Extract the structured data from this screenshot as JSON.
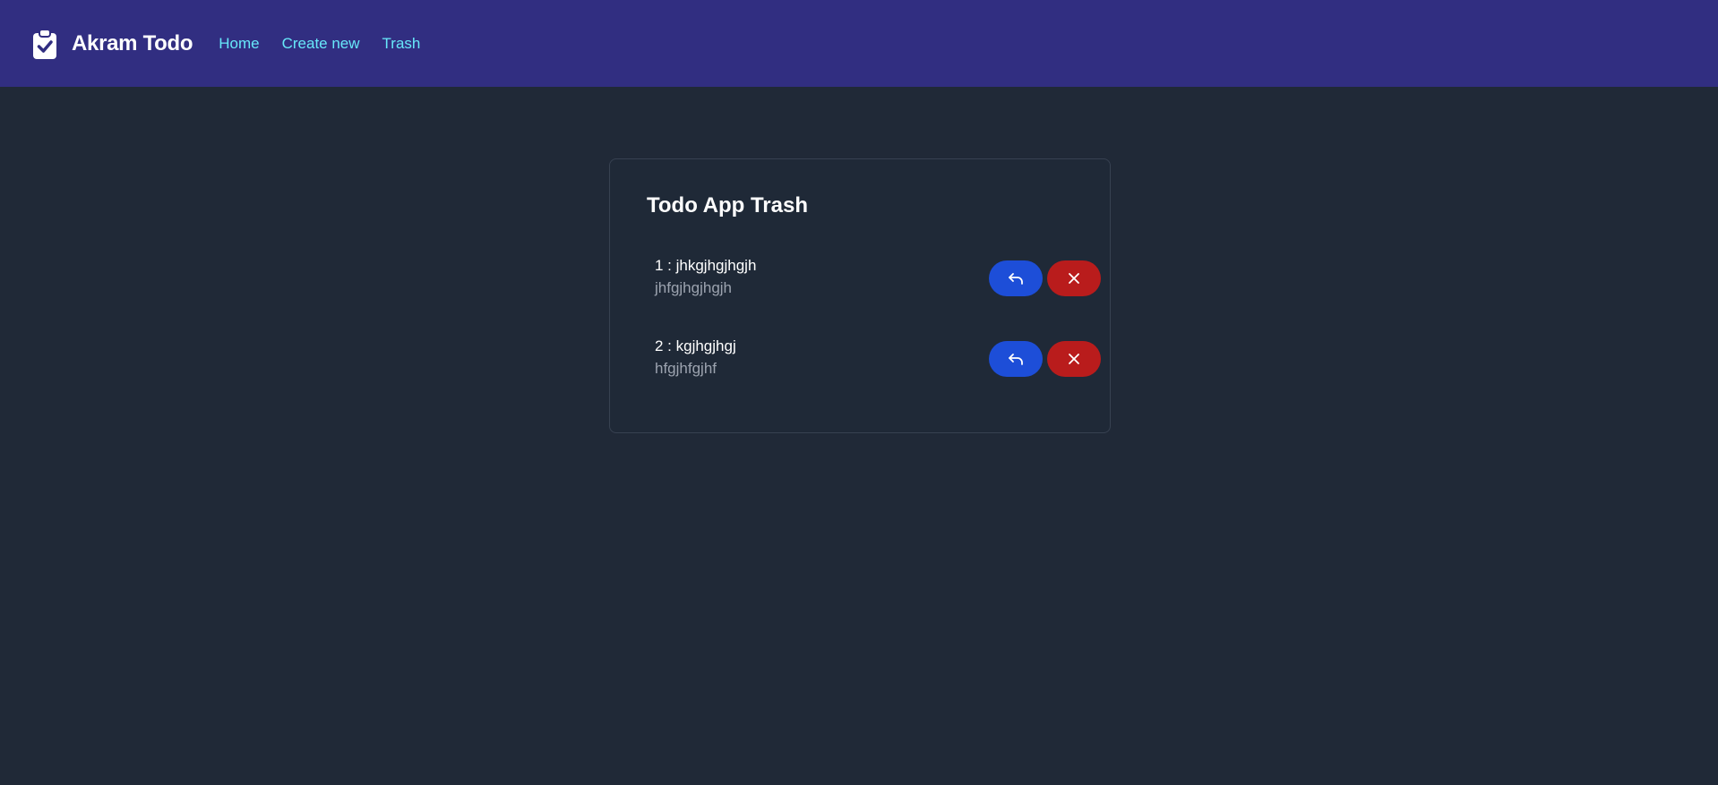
{
  "navbar": {
    "brand": "Akram Todo",
    "brand_icon": "clipboard-check-icon",
    "links": [
      {
        "label": "Home"
      },
      {
        "label": "Create new"
      },
      {
        "label": "Trash"
      }
    ],
    "link_color": "#67e8f9",
    "background": "#312e81"
  },
  "trash": {
    "title": "Todo App Trash",
    "items": [
      {
        "title": "1 : jhkgjhgjhgjh",
        "description": "jhfgjhgjhgjh"
      },
      {
        "title": "2 : kgjhgjhgj",
        "description": "hfgjhfgjhf"
      }
    ],
    "restore_icon": "undo-arrow-icon",
    "delete_icon": "close-icon",
    "restore_color": "#1d4ed8",
    "delete_color": "#b91c1c"
  }
}
